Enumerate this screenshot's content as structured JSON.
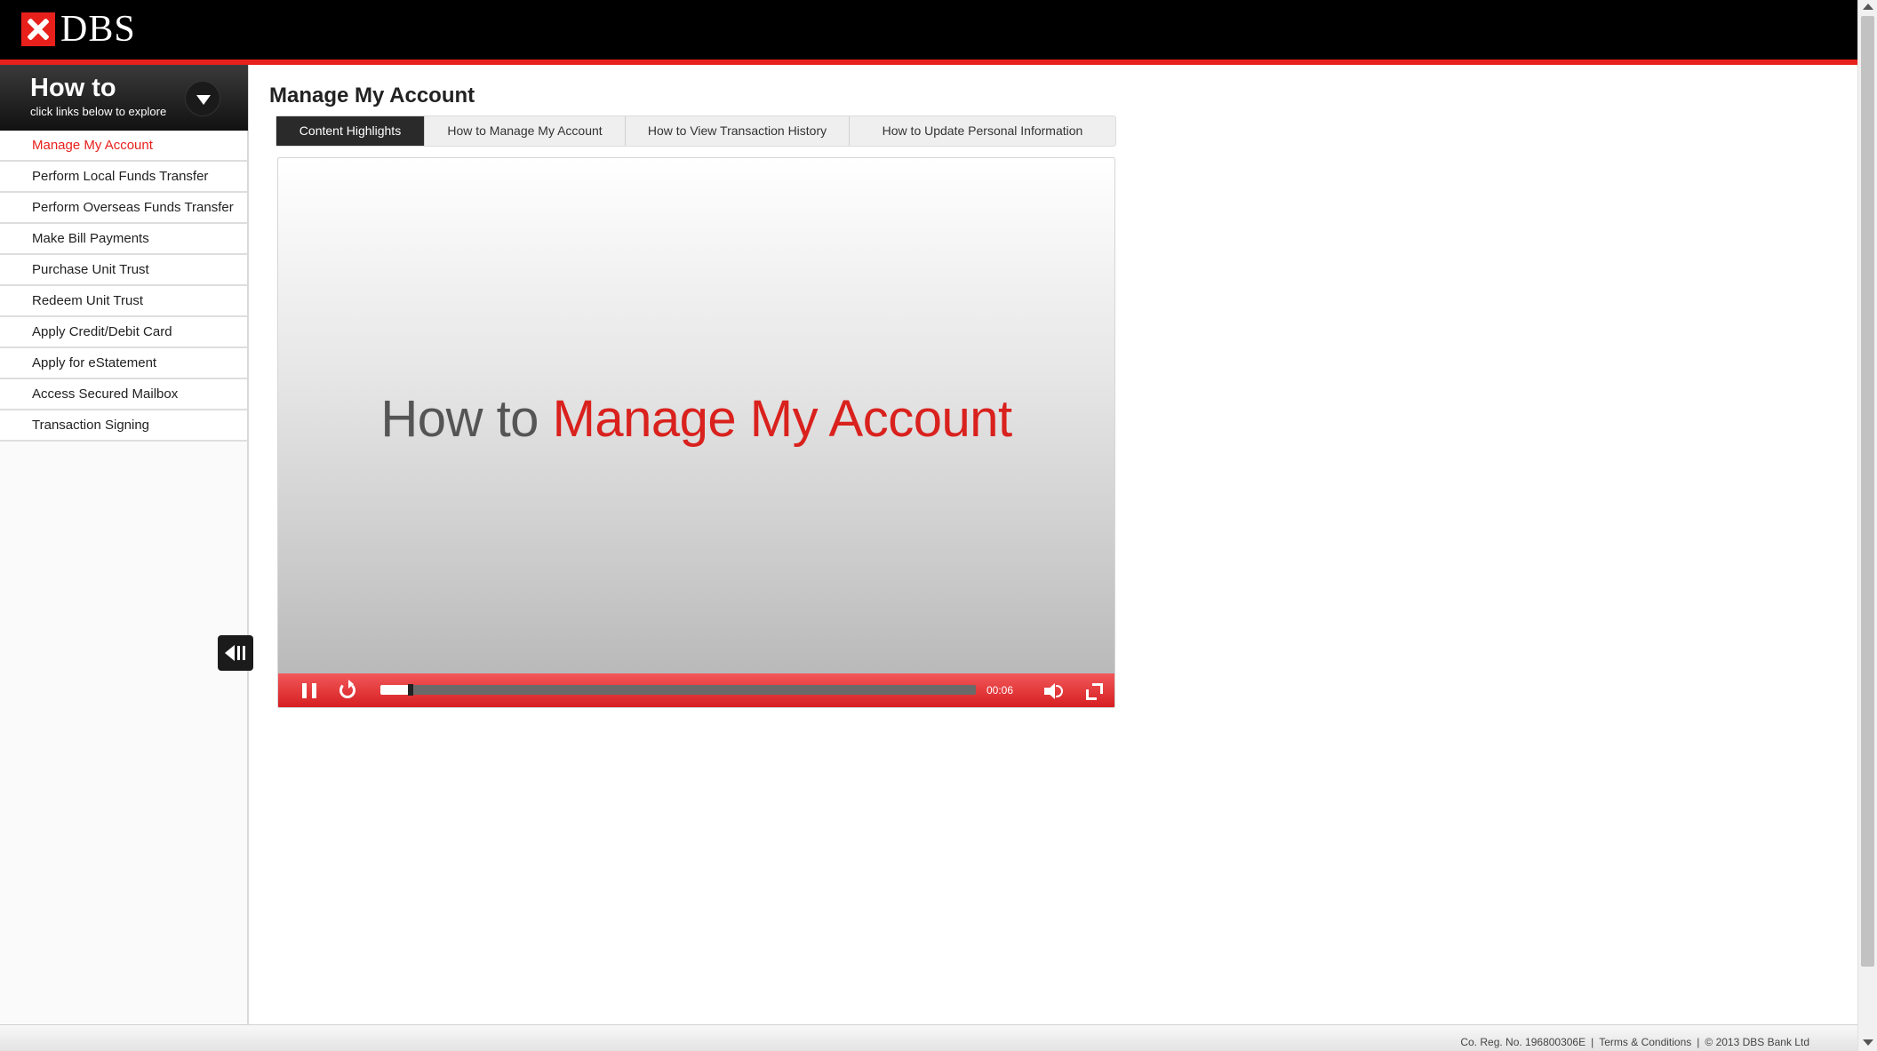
{
  "header": {
    "logo_text": "DBS",
    "accent": "#e8201c"
  },
  "sidebar": {
    "title": "How to",
    "subtitle": "click links below to explore",
    "items": [
      {
        "label": "Manage My Account",
        "active": true
      },
      {
        "label": "Perform Local Funds Transfer"
      },
      {
        "label": "Perform Overseas Funds Transfer"
      },
      {
        "label": "Make Bill Payments"
      },
      {
        "label": "Purchase Unit Trust"
      },
      {
        "label": "Redeem Unit Trust"
      },
      {
        "label": "Apply Credit/Debit Card"
      },
      {
        "label": "Apply for eStatement"
      },
      {
        "label": "Access Secured Mailbox"
      },
      {
        "label": "Transaction Signing"
      }
    ]
  },
  "main": {
    "title": "Manage My Account",
    "tabs": [
      {
        "label": "Content Highlights",
        "active": true
      },
      {
        "label": "How to Manage My Account"
      },
      {
        "label": "How to View Transaction History"
      },
      {
        "label": "How to Update Personal Information"
      }
    ]
  },
  "video": {
    "title_prefix": "How to",
    "title_highlight": "Manage My Account",
    "time": "00:06",
    "progress": 0.05
  },
  "footer": {
    "reg": "Co. Reg. No. 196800306E",
    "terms": "Terms & Conditions",
    "copyright": "© 2013 DBS Bank Ltd"
  }
}
